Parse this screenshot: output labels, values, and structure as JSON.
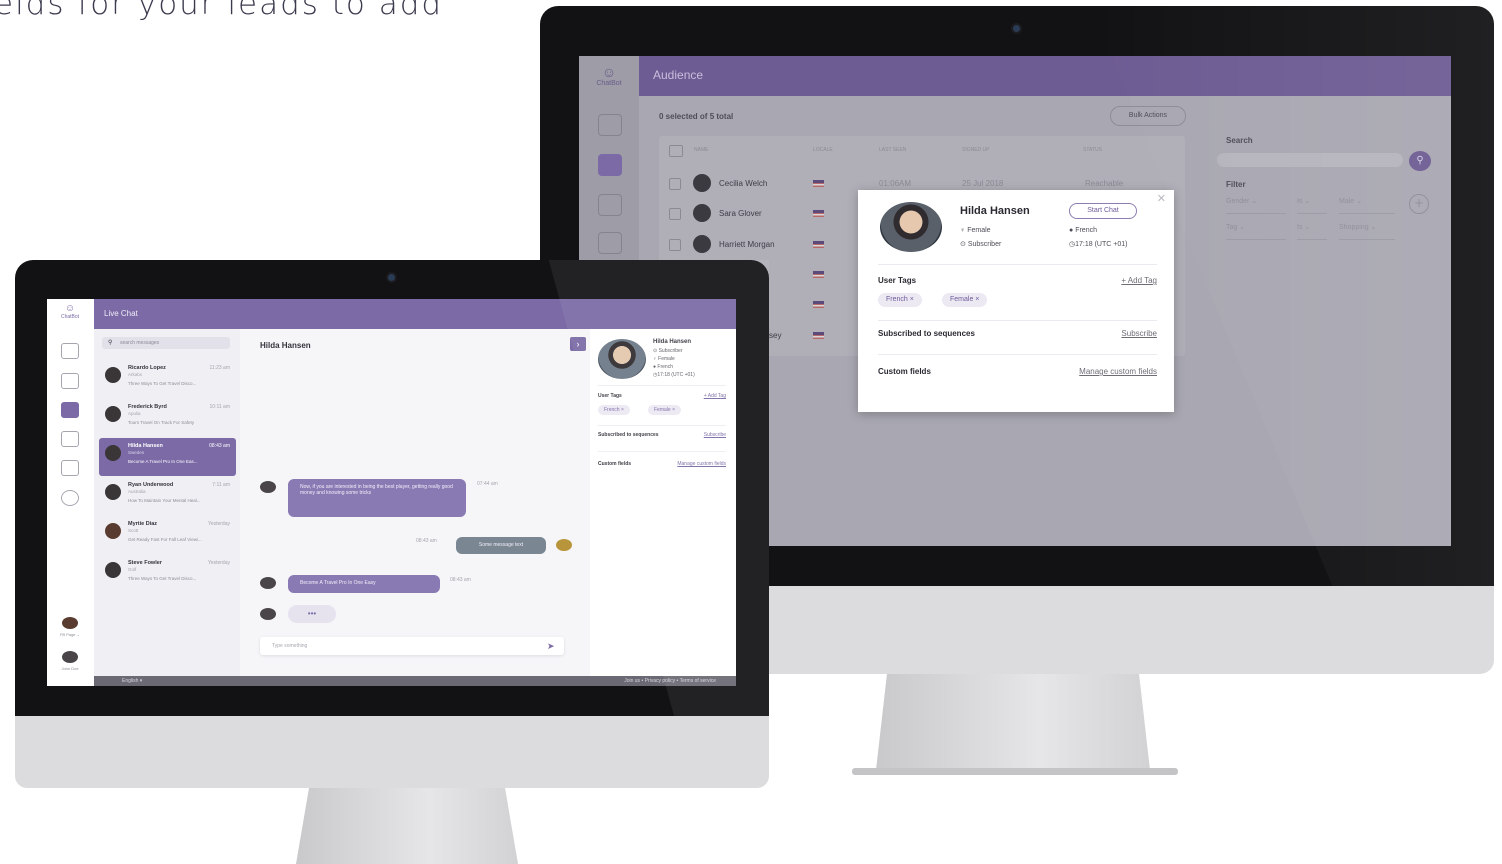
{
  "headline": "elds for your leads to add",
  "back_screen": {
    "logo_label": "ChatBot",
    "header_title": "Audience",
    "selection_count": "0 selected of 5 total",
    "bulk_actions": "Bulk Actions",
    "columns": [
      "NAME",
      "LOCALE",
      "LAST SEEN",
      "SIGNED UP",
      "STATUS"
    ],
    "rows": [
      {
        "name": "Cecilia Welch",
        "last_seen": "01:06AM",
        "signed_up": "25 Jul 2018",
        "status": "Reachable"
      },
      {
        "name": "Sara Glover",
        "last_seen": "",
        "signed_up": "",
        "status": ""
      },
      {
        "name": "Harriett Morgan",
        "last_seen": "",
        "signed_up": "",
        "status": ""
      },
      {
        "name": "",
        "last_seen": "",
        "signed_up": "",
        "status": ""
      },
      {
        "name": "",
        "last_seen": "",
        "signed_up": "",
        "status": ""
      },
      {
        "name": "ssey",
        "last_seen": "",
        "signed_up": "",
        "status": ""
      }
    ],
    "search_label": "Search",
    "filter_label": "Filter",
    "filters": [
      {
        "field": "Gender",
        "op": "Is",
        "value": "Male"
      },
      {
        "field": "Tag",
        "op": "Is",
        "value": "Shopping"
      }
    ],
    "modal": {
      "name": "Hilda Hansen",
      "start_chat": "Start Chat",
      "gender": "Female",
      "language": "French",
      "status": "Subscriber",
      "time": "17:18 (UTC +01)",
      "user_tags_label": "User Tags",
      "add_tag": "+ Add Tag",
      "tags": [
        "French",
        "Female"
      ],
      "sequences_label": "Subscribed to sequences",
      "subscribe": "Subscribe",
      "custom_fields_label": "Custom fields",
      "manage_fields": "Manage custom fields"
    }
  },
  "front_screen": {
    "logo_label": "ChatBot",
    "header_title": "Live Chat",
    "search_placeholder": "search messages",
    "conversations": [
      {
        "name": "Ricardo Lopez",
        "time": "11:23 am",
        "location": "Arkabs",
        "preview": "Three Ways To Get Travel Disco...",
        "active": false
      },
      {
        "name": "Frederick Byrd",
        "time": "10:11 am",
        "location": "Apulia",
        "preview": "Tours Travel On Track For Safety",
        "active": false
      },
      {
        "name": "Hilda Hansen",
        "time": "08:43 am",
        "location": "Sweden",
        "preview": "Become A Travel Pro In One Eas...",
        "active": true
      },
      {
        "name": "Ryan Underwood",
        "time": "7:11 am",
        "location": "Australia",
        "preview": "How To Maintain Your Mental Heal...",
        "active": false
      },
      {
        "name": "Myrtie Diaz",
        "time": "Yesterday",
        "location": "Scott",
        "preview": "Get Ready Fast For Fall Leaf Viewi...",
        "active": false
      },
      {
        "name": "Steve Fowler",
        "time": "Yesterday",
        "location": "Golf",
        "preview": "Three Ways To Get Travel Disco...",
        "active": false
      }
    ],
    "chat_title": "Hilda Hansen",
    "messages": [
      {
        "text": "Now, if you are interested in being the best player, getting really good money and knowing some tricks",
        "time": "07:44 am"
      },
      {
        "text": "Some message text",
        "time": "08:43 am"
      },
      {
        "text": "Become A Travel Pro In One Easy",
        "time": "08:43 am"
      }
    ],
    "typing_indicator": "•••",
    "input_placeholder": "Type something",
    "profile": {
      "name": "Hilda Hansen",
      "status": "Subscriber",
      "gender": "Female",
      "language": "French",
      "time": "17:18 (UTC +01)",
      "user_tags_label": "User Tags",
      "add_tag": "+ Add Tag",
      "tags": [
        "French",
        "Female"
      ],
      "sequences_label": "Subscribed to sequences",
      "subscribe": "Subscribe",
      "custom_fields_label": "Custom fields",
      "manage_fields": "Manage custom fields"
    },
    "page_label": "FB Page",
    "user_label": "John Doe",
    "footer_language": "English ▾",
    "footer_links": "Join us  •  Privacy policy  •  Terms of service"
  }
}
